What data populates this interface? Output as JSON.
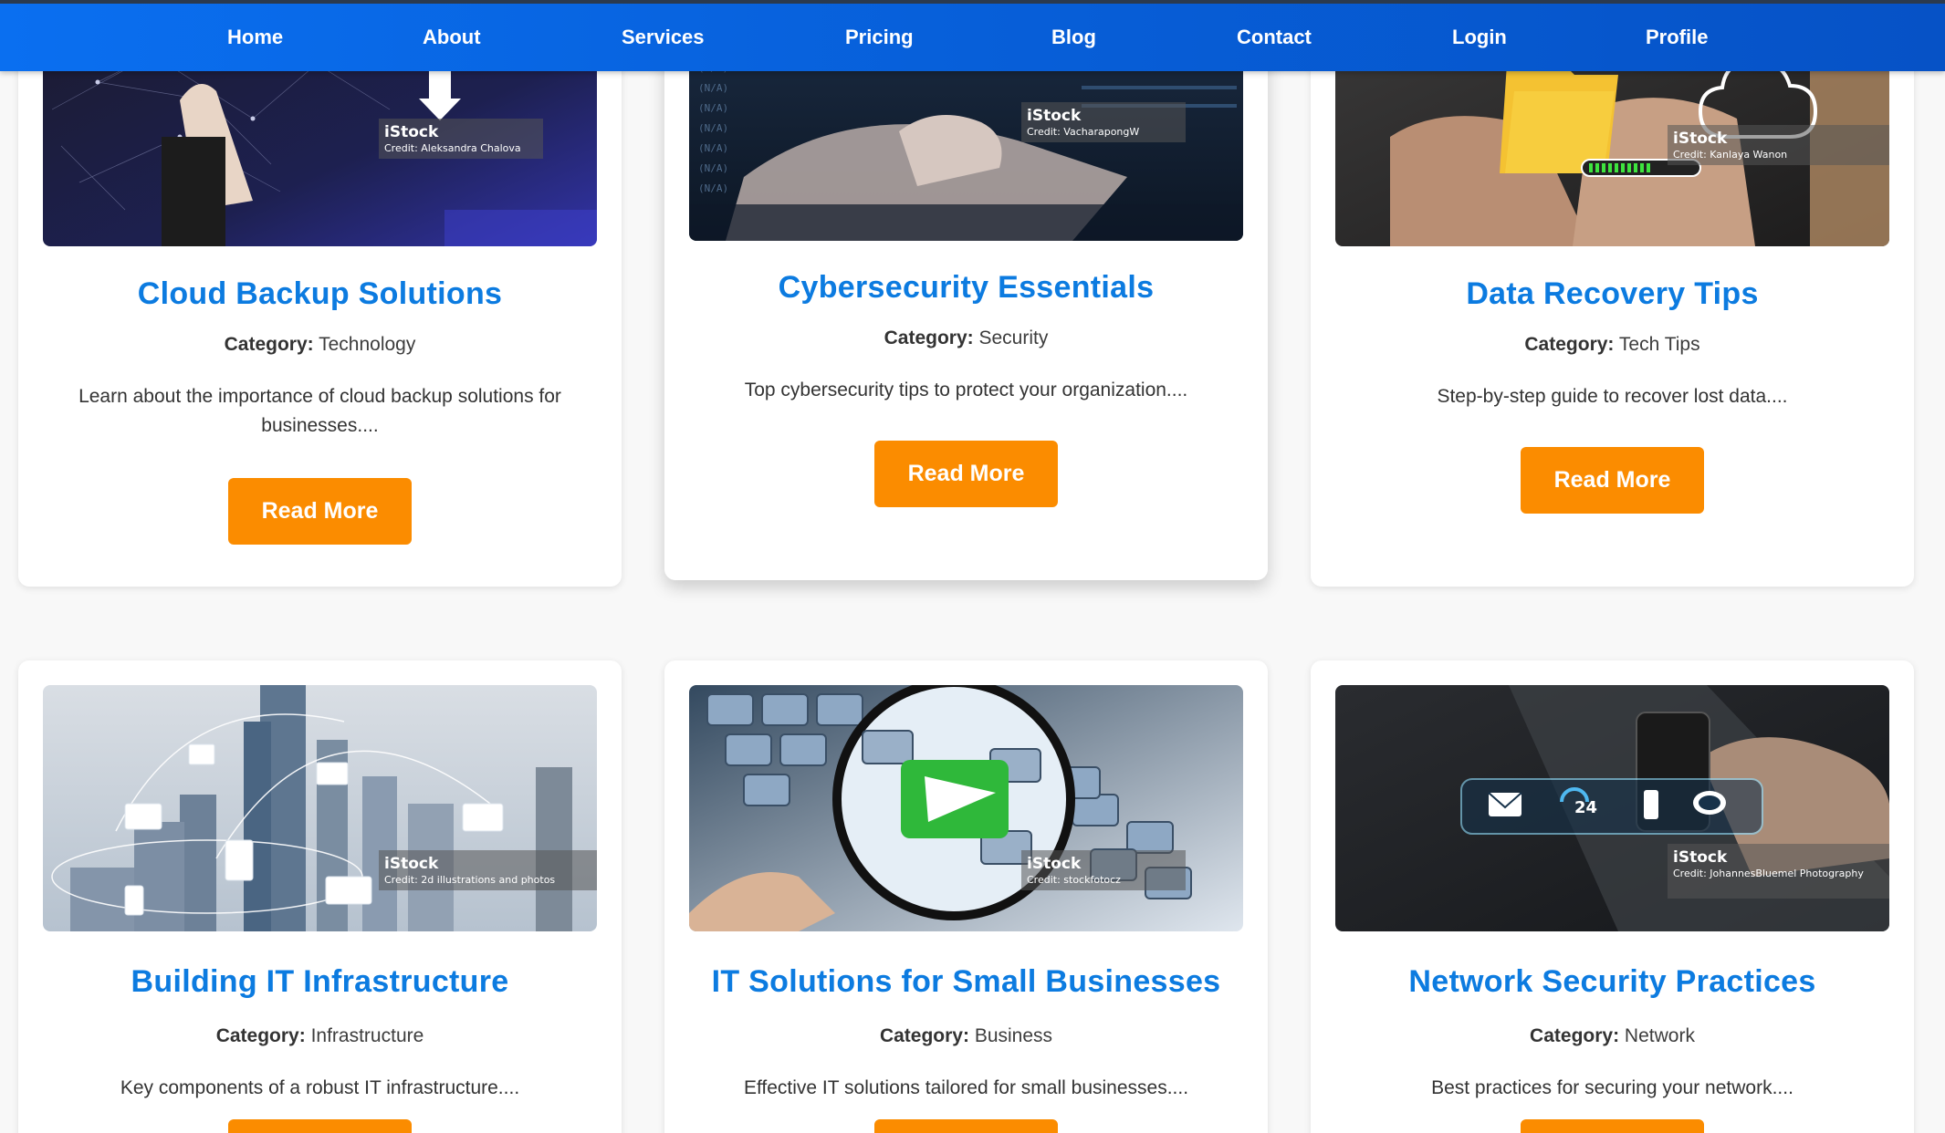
{
  "nav": {
    "home": "Home",
    "about": "About",
    "services": "Services",
    "pricing": "Pricing",
    "blog": "Blog",
    "contact": "Contact",
    "login": "Login",
    "profile": "Profile"
  },
  "category_label": "Category:",
  "read_more": "Read More",
  "colors": {
    "nav_bg": "#0a6ff0",
    "title": "#0c7be0",
    "button": "#fb8c00"
  },
  "posts": [
    {
      "title": "Cloud Backup Solutions",
      "category": "Technology",
      "excerpt": "Learn about the importance of cloud backup solutions for businesses....",
      "image_watermark": "iStock",
      "image_credit": "Credit: Aleksandra Chalova"
    },
    {
      "title": "Cybersecurity Essentials",
      "category": "Security",
      "excerpt": "Top cybersecurity tips to protect your organization....",
      "image_watermark": "iStock",
      "image_credit": "Credit: VacharapongW"
    },
    {
      "title": "Data Recovery Tips",
      "category": "Tech Tips",
      "excerpt": "Step-by-step guide to recover lost data....",
      "image_watermark": "iStock",
      "image_credit": "Credit: Kanlaya Wanon"
    },
    {
      "title": "Building IT Infrastructure",
      "category": "Infrastructure",
      "excerpt": "Key components of a robust IT infrastructure....",
      "image_watermark": "iStock",
      "image_credit": "Credit: 2d illustrations and photos"
    },
    {
      "title": "IT Solutions for Small Businesses",
      "category": "Business",
      "excerpt": "Effective IT solutions tailored for small businesses....",
      "image_watermark": "iStock",
      "image_credit": "Credit: stockfotocz"
    },
    {
      "title": "Network Security Practices",
      "category": "Network",
      "excerpt": "Best practices for securing your network....",
      "image_watermark": "iStock",
      "image_credit": "Credit: JohannesBluemel Photography"
    }
  ]
}
